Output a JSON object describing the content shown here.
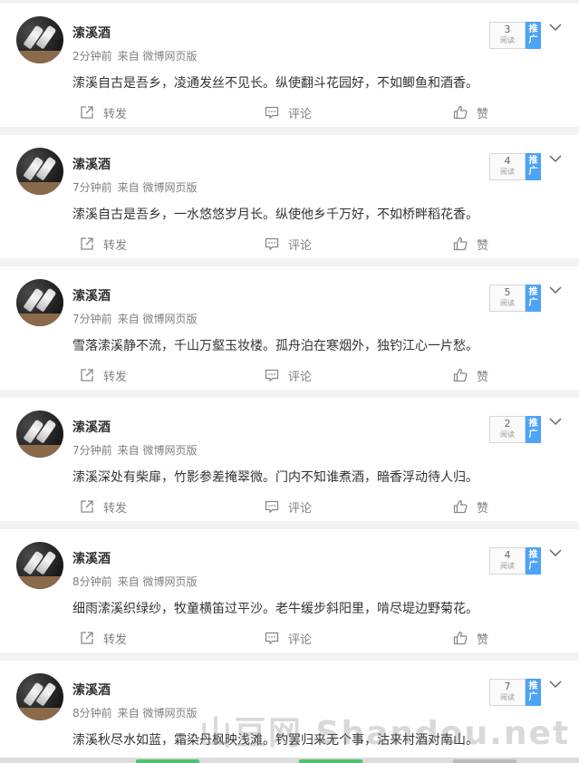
{
  "colors": {
    "accent": "#4da3f5",
    "text": "#333333",
    "muted": "#808080",
    "separator": "#f2f2f5"
  },
  "labels": {
    "read": "阅读",
    "promote": "推广",
    "repost": "转发",
    "comment": "评论",
    "like": "赞"
  },
  "posts": [
    {
      "author": "溹溪酒",
      "time": "2分钟前",
      "source": "来自 微博网页版",
      "content": "溹溪自古是吾乡，凌通发丝不见长。纵使翻斗花园好，不如鲫鱼和酒香。",
      "read_count": "3"
    },
    {
      "author": "溹溪酒",
      "time": "7分钟前",
      "source": "来自 微博网页版",
      "content": "溹溪自古是吾乡，一水悠悠岁月长。纵使他乡千万好，不如桥畔稻花香。",
      "read_count": "4"
    },
    {
      "author": "溹溪酒",
      "time": "7分钟前",
      "source": "来自 微博网页版",
      "content": "雪落溹溪静不流，千山万壑玉妆楼。孤舟泊在寒烟外，独钓江心一片愁。",
      "read_count": "5"
    },
    {
      "author": "溹溪酒",
      "time": "7分钟前",
      "source": "来自 微博网页版",
      "content": "溹溪深处有柴扉，竹影参差掩翠微。门内不知谁煮酒，暗香浮动待人归。",
      "read_count": "2"
    },
    {
      "author": "溹溪酒",
      "time": "8分钟前",
      "source": "来自 微博网页版",
      "content": "细雨溹溪织绿纱，牧童横笛过平沙。老牛缓步斜阳里，啃尽堤边野菊花。",
      "read_count": "4"
    },
    {
      "author": "溹溪酒",
      "time": "8分钟前",
      "source": "来自 微博网页版",
      "content": "溹溪秋尽水如蓝，霜染丹枫映浅滩。钓罢归来无个事，沽来村酒对南山。",
      "read_count": "7"
    }
  ],
  "watermark": "山豆网 Shandou.net"
}
